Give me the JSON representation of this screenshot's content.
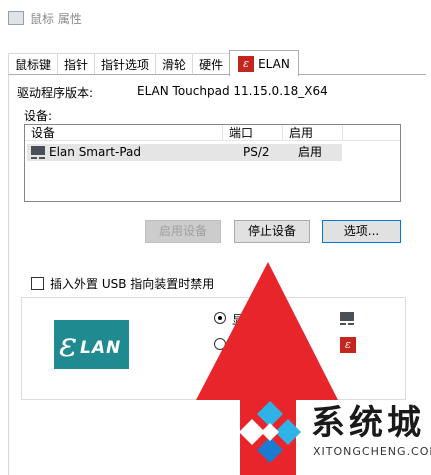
{
  "window": {
    "title": "鼠标 属性"
  },
  "tabs": [
    {
      "label": "鼠标键"
    },
    {
      "label": "指针"
    },
    {
      "label": "指针选项"
    },
    {
      "label": "滑轮"
    },
    {
      "label": "硬件"
    },
    {
      "label": "ELAN",
      "active": true
    }
  ],
  "driver": {
    "label": "驱动程序版本:",
    "value": "ELAN Touchpad 11.15.0.18_X64"
  },
  "devices": {
    "label": "设备:",
    "columns": [
      "设备",
      "端口",
      "启用"
    ],
    "rows": [
      {
        "device": "Elan Smart-Pad",
        "port": "PS/2",
        "enabled": "启用"
      }
    ]
  },
  "buttons": {
    "enable": "启用设备",
    "disable": "停止设备",
    "options": "选项..."
  },
  "usb_checkbox": {
    "label": "插入外置 USB 指向装置时禁用",
    "checked": false
  },
  "display_options": {
    "radio1_label": "显示",
    "radio1_selected": true
  },
  "watermark": {
    "name": "系统城",
    "url": "XITONGCHENG.COM"
  },
  "colors": {
    "accent": "#0078d7",
    "arrow": "#e8252b",
    "elan_red": "#c4261d",
    "logo_teal": "#1f8a8f"
  },
  "icons": [
    "app-icon",
    "elan-tab-icon",
    "touchpad-device-icon",
    "elan-logo",
    "tray-touchpad-icon",
    "tray-elan-icon",
    "red-arrow",
    "watermark-diamond-icon"
  ]
}
